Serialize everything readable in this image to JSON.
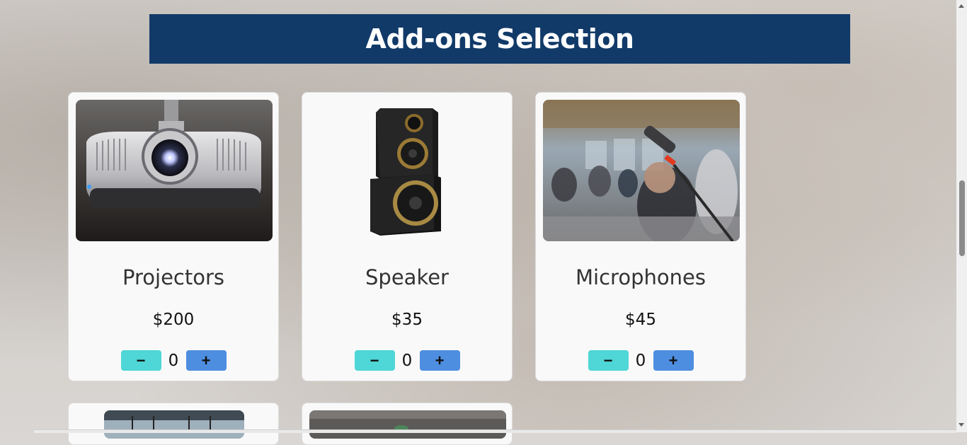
{
  "page": {
    "title": "Add-ons Selection"
  },
  "addons": [
    {
      "name": "Projectors",
      "price": "$200",
      "quantity": "0",
      "minus_label": "−",
      "plus_label": "+",
      "image": "projector-photo"
    },
    {
      "name": "Speaker",
      "price": "$35",
      "quantity": "0",
      "minus_label": "−",
      "plus_label": "+",
      "image": "speaker-photo"
    },
    {
      "name": "Microphones",
      "price": "$45",
      "quantity": "0",
      "minus_label": "−",
      "plus_label": "+",
      "image": "microphone-photo"
    }
  ],
  "colors": {
    "header_bg": "#113a68",
    "minus_button": "#4fd6d6",
    "plus_button": "#4d8ee0",
    "card_bg": "#f9f9f9"
  }
}
